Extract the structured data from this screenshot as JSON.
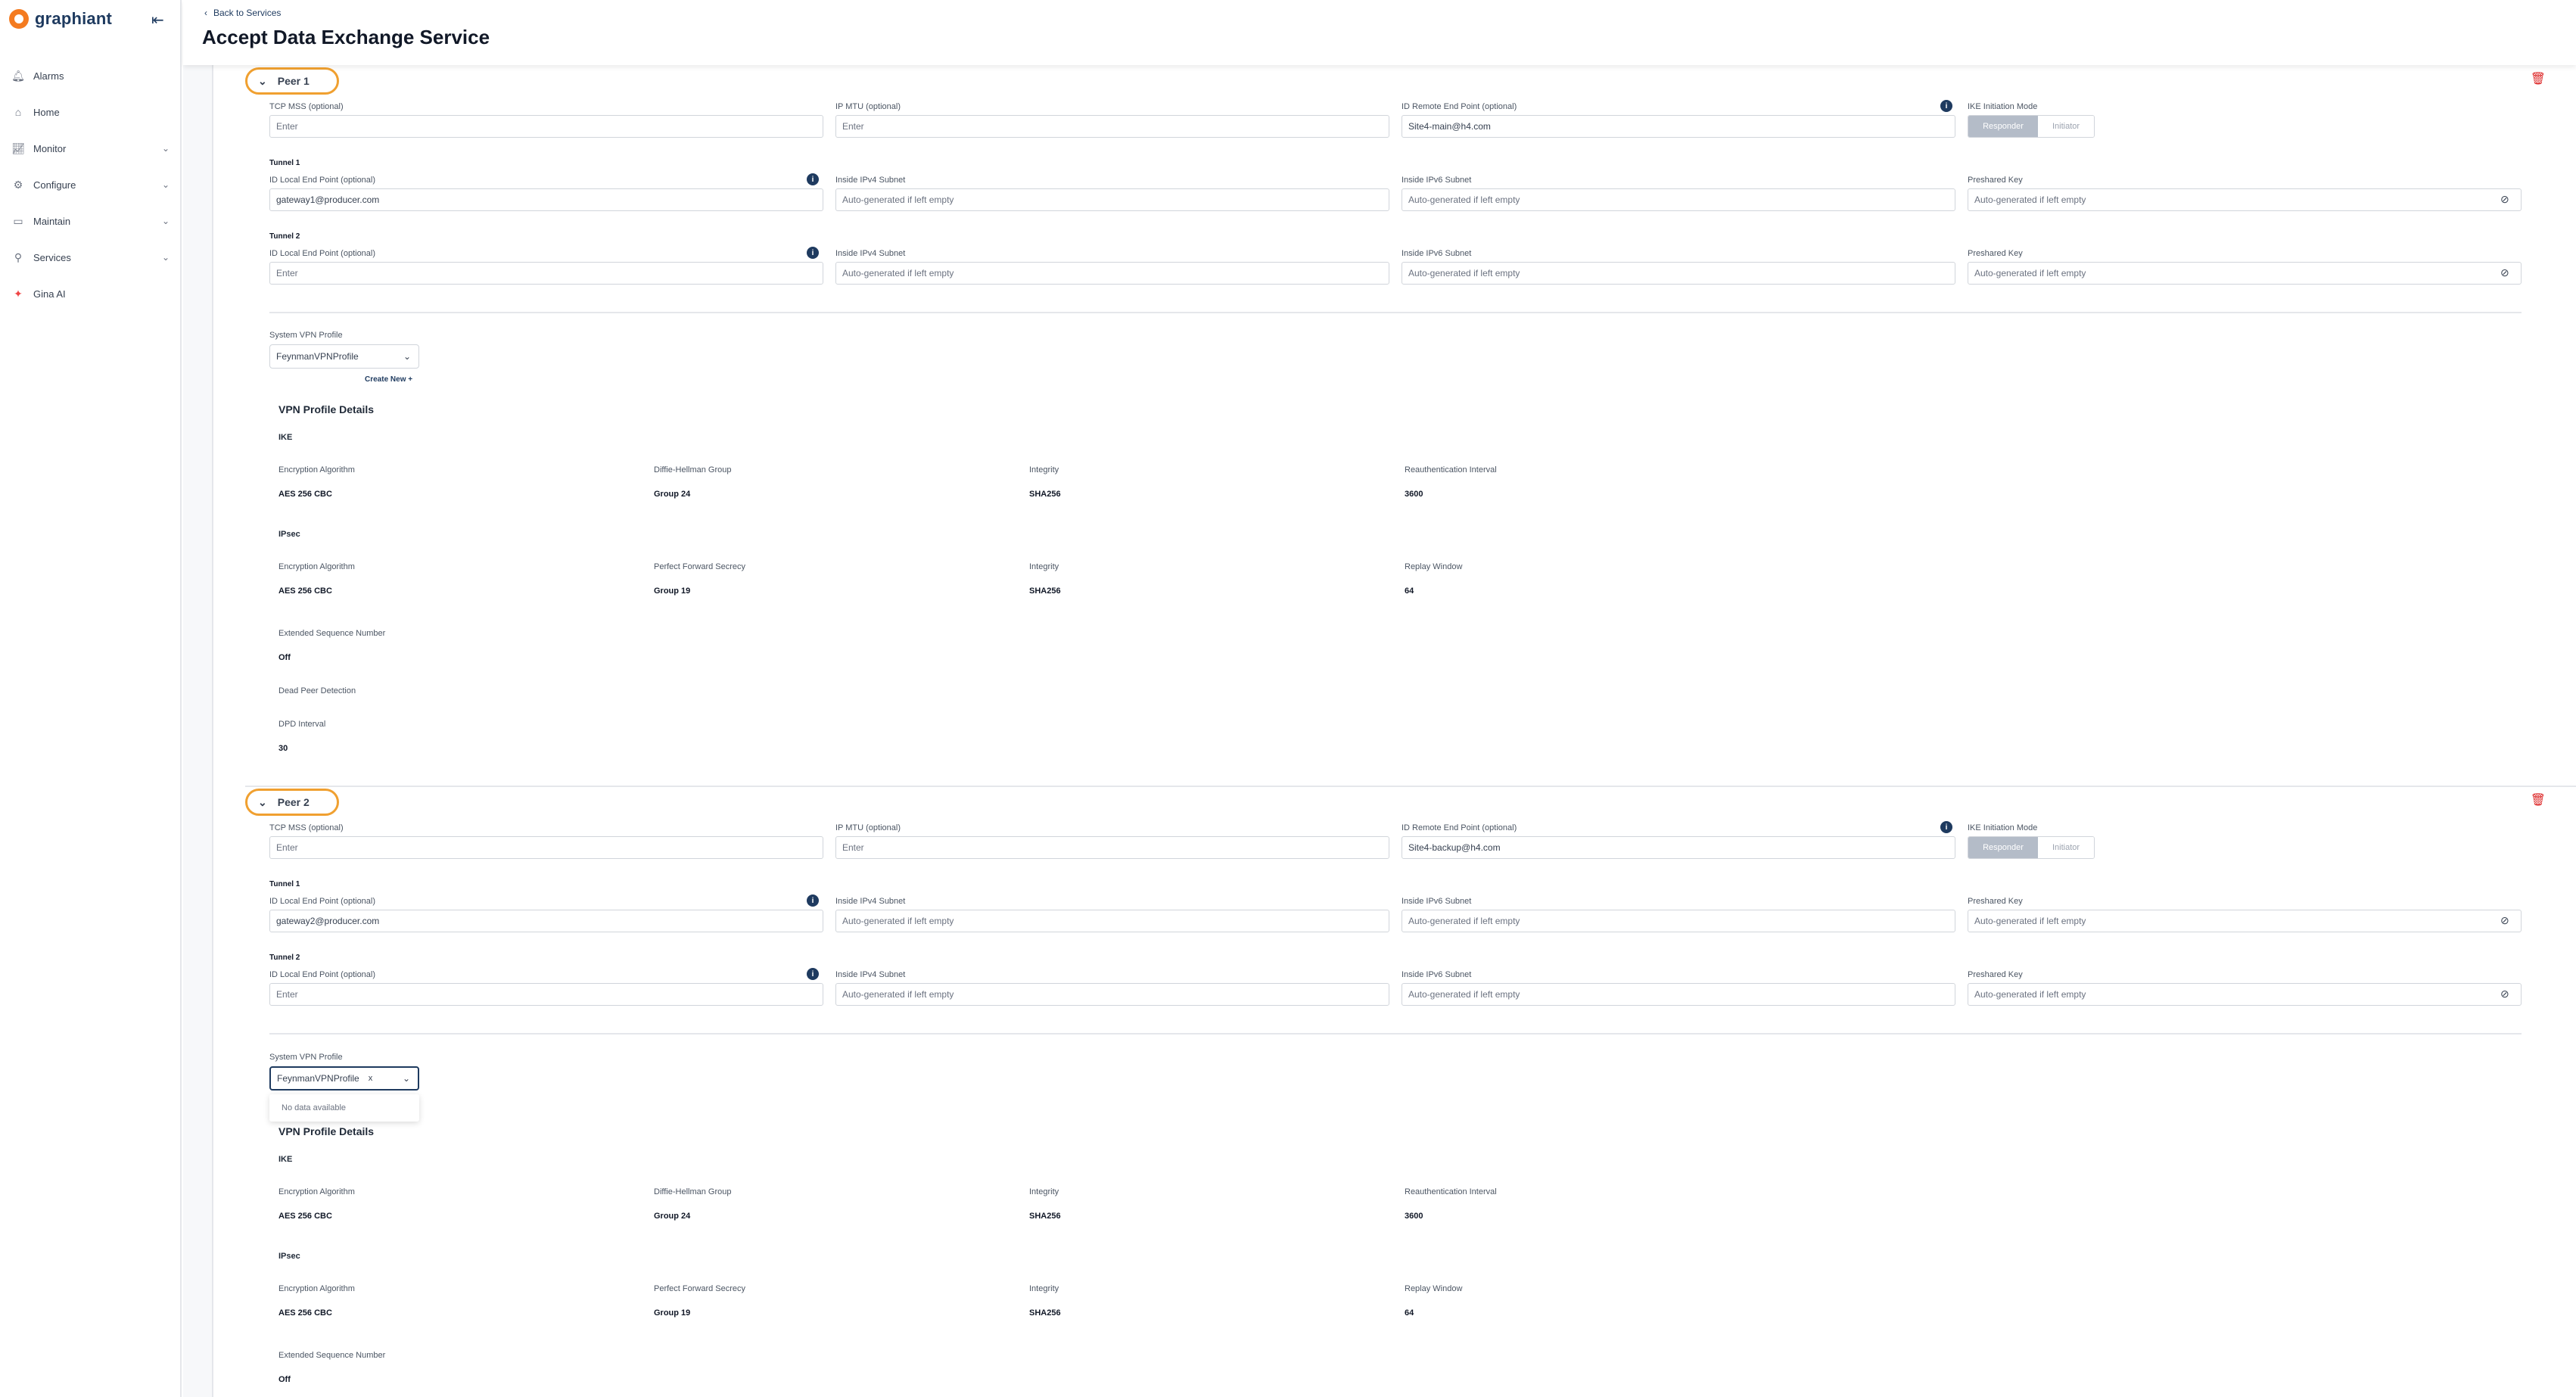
{
  "app": {
    "logo_text": "graphiant",
    "collapse_icon": "collapse-sidebar-icon"
  },
  "sidebar": {
    "items": [
      {
        "label": "Alarms",
        "icon": "bell-icon",
        "has_chevron": false
      },
      {
        "label": "Home",
        "icon": "home-icon",
        "has_chevron": false
      },
      {
        "label": "Monitor",
        "icon": "chart-line-icon",
        "has_chevron": true
      },
      {
        "label": "Configure",
        "icon": "gear-icon",
        "has_chevron": true
      },
      {
        "label": "Maintain",
        "icon": "toolbox-icon",
        "has_chevron": true
      },
      {
        "label": "Services",
        "icon": "services-icon",
        "has_chevron": true
      },
      {
        "label": "Gina AI",
        "icon": "sparkle-icon",
        "has_chevron": false
      }
    ]
  },
  "header": {
    "back_label": "Back to Services",
    "title": "Accept Data Exchange Service"
  },
  "labels": {
    "tcp_mss": "TCP MSS (optional)",
    "ip_mtu": "IP MTU (optional)",
    "id_remote": "ID Remote End Point (optional)",
    "ike_mode": "IKE Initiation Mode",
    "responder": "Responder",
    "initiator": "Initiator",
    "tunnel1": "Tunnel 1",
    "tunnel2": "Tunnel 2",
    "id_local": "ID Local End Point (optional)",
    "ipv4": "Inside IPv4 Subnet",
    "ipv6": "Inside IPv6 Subnet",
    "psk": "Preshared Key",
    "enter": "Enter",
    "auto": "Auto-generated if left empty",
    "vpn_profile": "System VPN Profile",
    "create_new": "Create New +",
    "details": "VPN Profile Details",
    "ike": "IKE",
    "ipsec": "IPsec",
    "enc_alg": "Encryption Algorithm",
    "dh_group": "Diffie-Hellman Group",
    "integrity": "Integrity",
    "reauth": "Reauthentication Interval",
    "pfs": "Perfect Forward Secrecy",
    "replay": "Replay Window",
    "esn": "Extended Sequence Number",
    "dpd": "Dead Peer Detection",
    "dpd_interval": "DPD Interval",
    "no_data": "No data available"
  },
  "peer1": {
    "name": "Peer 1",
    "tcp_mss": "",
    "ip_mtu": "",
    "id_remote": "Site4-main@h4.com",
    "tunnel1_local": "gateway1@producer.com",
    "tunnel2_local": "",
    "profile": "FeynmanVPNProfile",
    "ike": {
      "enc": "AES 256 CBC",
      "dh": "Group 24",
      "integrity": "SHA256",
      "reauth": "3600"
    },
    "ipsec": {
      "enc": "AES 256 CBC",
      "pfs": "Group 19",
      "integrity": "SHA256",
      "replay": "64",
      "esn": "Off",
      "dpd_interval": "30"
    }
  },
  "peer2": {
    "name": "Peer 2",
    "tcp_mss": "",
    "ip_mtu": "",
    "id_remote": "Site4-backup@h4.com",
    "tunnel1_local": "gateway2@producer.com",
    "tunnel2_local": "",
    "profile": "FeynmanVPNProfile",
    "clear_icon": "x",
    "ike": {
      "enc": "AES 256 CBC",
      "dh": "Group 24",
      "integrity": "SHA256",
      "reauth": "3600"
    },
    "ipsec": {
      "enc": "AES 256 CBC",
      "pfs": "Group 19",
      "integrity": "SHA256",
      "replay": "64",
      "esn": "Off"
    }
  },
  "colors": {
    "accent": "#1e3a5f",
    "highlight": "#f0a030",
    "danger": "#dc2626",
    "brand": "#f47b20"
  }
}
